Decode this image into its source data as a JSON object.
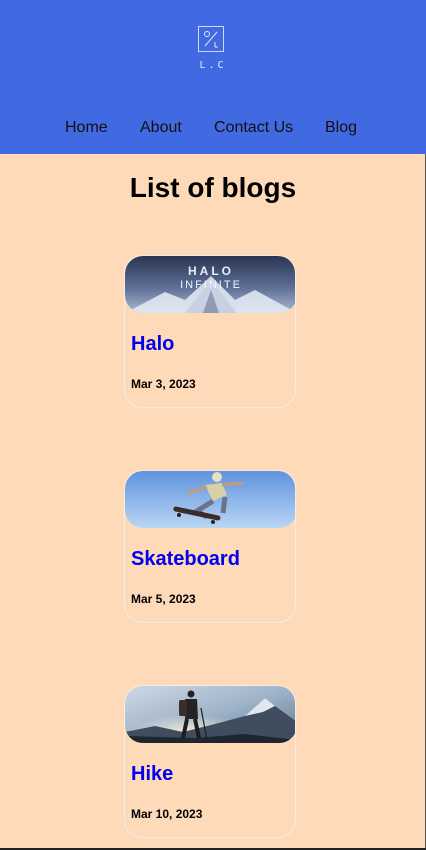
{
  "header": {
    "logo_text": "L.C",
    "bg_color": "#4169e1"
  },
  "nav": {
    "items": [
      {
        "label": "Home"
      },
      {
        "label": "About"
      },
      {
        "label": "Contact Us"
      },
      {
        "label": "Blog"
      }
    ]
  },
  "main": {
    "title": "List of blogs",
    "background": "#ffdab9",
    "posts": [
      {
        "title": "Halo",
        "date": "Mar 3, 2023",
        "image_logo_text": "HALO",
        "image_sub_text": "INFINITE",
        "image": "halo-infinite-cover"
      },
      {
        "title": "Skateboard",
        "date": "Mar 5, 2023",
        "image": "skateboarder-jump-photo"
      },
      {
        "title": "Hike",
        "date": "Mar 10, 2023",
        "image": "hiker-mountain-sunset-photo"
      }
    ]
  },
  "colors": {
    "link": "#0000ee",
    "title": "#000000"
  }
}
